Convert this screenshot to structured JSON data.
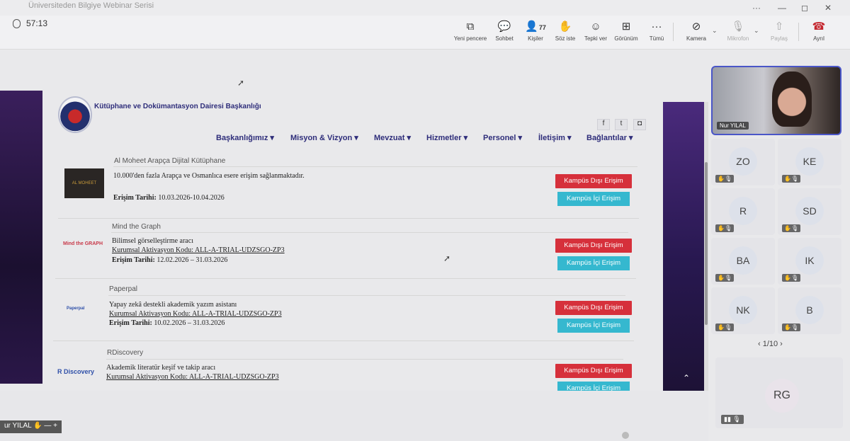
{
  "window": {
    "title": "Üniversiteden Bilgiye Webinar Serisi",
    "ctrl_more": "···",
    "ctrl_min": "—",
    "ctrl_max": "◻",
    "ctrl_close": "✕"
  },
  "toolbar": {
    "timer": "57:13",
    "buttons": [
      {
        "label": "Yeni pencere",
        "icon": "⧉"
      },
      {
        "label": "Sohbet",
        "icon": "💬"
      },
      {
        "label": "Kişiler",
        "icon": "👤",
        "count": "77"
      },
      {
        "label": "Söz iste",
        "icon": "✋"
      },
      {
        "label": "Tepki ver",
        "icon": "☺"
      },
      {
        "label": "Görünüm",
        "icon": "⊞"
      },
      {
        "label": "Tümü",
        "icon": "···"
      },
      {
        "label": "Kamera",
        "icon": "⊘"
      },
      {
        "label": "Mikrofon",
        "icon": "🎙"
      },
      {
        "label": "Paylaş",
        "icon": "⇧"
      },
      {
        "label": "Ayrıl",
        "icon": "☎"
      }
    ],
    "chevron": "⌄"
  },
  "website": {
    "title": "Kütüphane ve Dokümantasyon Dairesi Başkanlığı",
    "social": [
      "f",
      "t",
      "◘"
    ],
    "nav": [
      "Başkanlığımız ▾",
      "Misyon & Vizyon ▾",
      "Mevzuat ▾",
      "Hizmetler ▾",
      "Personel ▾",
      "İletişim ▾",
      "Bağlantılar ▾"
    ],
    "scroll_up": "⌃",
    "databases": [
      {
        "name": "Al Moheet Arapça Dijital Kütüphane",
        "logo": "AL MOHEET",
        "desc": "10.000'den fazla Arapça ve Osmanlıca esere erişim sağlanmaktadır.",
        "code": "",
        "date_label": "Erişim Tarihi:",
        "date_value": "10.03.2026-10.04.2026",
        "btn_out": "Kampüs Dışı Erişim",
        "btn_in": "Kampüs İçi Erişim"
      },
      {
        "name": "Mind the Graph",
        "logo": "Mind the GRAPH",
        "desc": "Bilimsel görselleştirme aracı",
        "code": "Kurumsal Aktivasyon Kodu: ALL-A-TRIAL-UDZSGO-ZP3",
        "date_label": "Erişim Tarihi:",
        "date_value": "12.02.2026 – 31.03.2026",
        "btn_out": "Kampüs Dışı Erişim",
        "btn_in": "Kampüs İçi Erişim"
      },
      {
        "name": "Paperpal",
        "logo": "Paperpal",
        "desc": "Yapay zekâ destekli akademik yazım asistanı",
        "code": "Kurumsal Aktivasyon Kodu: ALL-A-TRIAL-UDZSGO-ZP3",
        "date_label": "Erişim Tarihi:",
        "date_value": "10.02.2026 – 31.03.2026",
        "btn_out": "Kampüs Dışı Erişim",
        "btn_in": "Kampüs İçi Erişim"
      },
      {
        "name": "RDiscovery",
        "logo": "R Discovery",
        "desc": "Akademik literatür keşif ve takip aracı",
        "code": "Kurumsal Aktivasyon Kodu: ALL-A-TRIAL-UDZSGO-ZP3",
        "date_label": "",
        "date_value": "",
        "btn_out": "Kampüs Dışı Erişim",
        "btn_in": "Kampüs İçi Erişim"
      }
    ]
  },
  "participants": {
    "speaker": "Nur YILAL",
    "tiles": [
      "ZO",
      "KE",
      "R",
      "SD",
      "BA",
      "IK",
      "NK",
      "B"
    ],
    "pager": "‹  1/10  ›",
    "big_tile": "RG",
    "mic_label": "✋🎙",
    "big_mic_label": "▮▮ 🎙"
  },
  "self_view": {
    "label": "ur YILAL ✋ —  +"
  },
  "colors": {
    "accent": "#4a56c8",
    "leave": "#c4262e",
    "btn_outside": "#d6303b",
    "btn_inside": "#35b8cf",
    "site_title": "#2e2d7a"
  }
}
